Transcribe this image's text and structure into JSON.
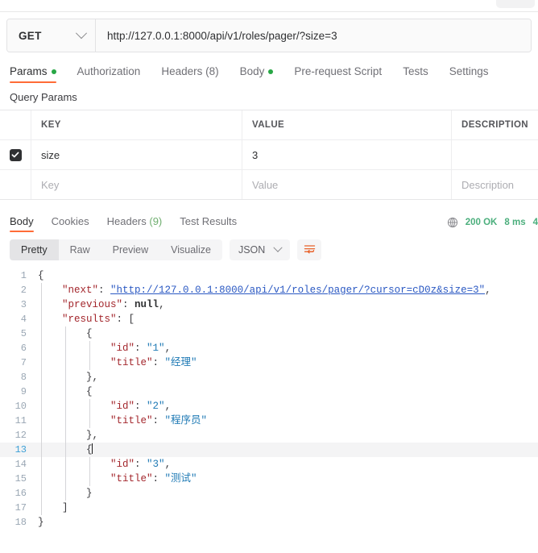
{
  "window": {
    "tab_chip": ""
  },
  "request": {
    "method": "GET",
    "url": "http://127.0.0.1:8000/api/v1/roles/pager/?size=3",
    "tabs": [
      {
        "label": "Params",
        "dot": true,
        "active": true
      },
      {
        "label": "Authorization",
        "dot": false,
        "active": false
      },
      {
        "label": "Headers (8)",
        "dot": false,
        "active": false
      },
      {
        "label": "Body",
        "dot": true,
        "active": false
      },
      {
        "label": "Pre-request Script",
        "dot": false,
        "active": false
      },
      {
        "label": "Tests",
        "dot": false,
        "active": false
      },
      {
        "label": "Settings",
        "dot": false,
        "active": false
      }
    ],
    "tab_labels": {
      "params": "Params",
      "authorization": "Authorization",
      "headers": "Headers (8)",
      "body": "Body",
      "prerequest": "Pre-request Script",
      "tests": "Tests",
      "settings": "Settings"
    }
  },
  "query_params": {
    "section_title": "Query Params",
    "columns": {
      "key": "KEY",
      "value": "VALUE",
      "description": "DESCRIPTION"
    },
    "rows": [
      {
        "checked": true,
        "key": "size",
        "value": "3",
        "description": ""
      }
    ],
    "placeholder_row": {
      "key": "Key",
      "value": "Value",
      "description": "Description"
    }
  },
  "response": {
    "tabs": {
      "body": "Body",
      "cookies": "Cookies",
      "headers_label": "Headers",
      "headers_count": "(9)",
      "test_results": "Test Results"
    },
    "status": "200 OK",
    "time": "8 ms",
    "size": "4",
    "format_tabs": {
      "pretty": "Pretty",
      "raw": "Raw",
      "preview": "Preview",
      "visualize": "Visualize"
    },
    "language": "JSON"
  },
  "code": {
    "lines": [
      {
        "num": "1",
        "active": false
      },
      {
        "num": "2",
        "active": false
      },
      {
        "num": "3",
        "active": false
      },
      {
        "num": "4",
        "active": false
      },
      {
        "num": "5",
        "active": false
      },
      {
        "num": "6",
        "active": false
      },
      {
        "num": "7",
        "active": false
      },
      {
        "num": "8",
        "active": false
      },
      {
        "num": "9",
        "active": false
      },
      {
        "num": "10",
        "active": false
      },
      {
        "num": "11",
        "active": false
      },
      {
        "num": "12",
        "active": false
      },
      {
        "num": "13",
        "active": true
      },
      {
        "num": "14",
        "active": false
      },
      {
        "num": "15",
        "active": false
      },
      {
        "num": "16",
        "active": false
      },
      {
        "num": "17",
        "active": false
      },
      {
        "num": "18",
        "active": false
      }
    ],
    "tokens": {
      "brace_open": "{",
      "brace_close": "}",
      "brace_close_comma": "},",
      "bracket_open": "[",
      "bracket_close": "]",
      "key_next": "\"next\"",
      "key_previous": "\"previous\"",
      "key_results": "\"results\"",
      "key_id": "\"id\"",
      "key_title": "\"title\"",
      "colon": ": ",
      "comma": ",",
      "val_next_url": "\"http://127.0.0.1:8000/api/v1/roles/pager/?cursor=cD0z&size=3\"",
      "val_null": "null",
      "val_id_1": "\"1\"",
      "val_id_2": "\"2\"",
      "val_id_3": "\"3\"",
      "val_title_1": "\"经理\"",
      "val_title_2": "\"程序员\"",
      "val_title_3": "\"测试\""
    },
    "response_json": {
      "next": "http://127.0.0.1:8000/api/v1/roles/pager/?cursor=cD0z&size=3",
      "previous": null,
      "results": [
        {
          "id": "1",
          "title": "经理"
        },
        {
          "id": "2",
          "title": "程序员"
        },
        {
          "id": "3",
          "title": "测试"
        }
      ]
    }
  },
  "colors": {
    "accent": "#ff6c37",
    "success": "#28a745",
    "status_green": "#4caf7d",
    "key_red": "#a3262c",
    "string_blue": "#1f7ab5",
    "url_blue": "#2b59c3",
    "gutter": "#9aa7b4",
    "active_gutter": "#3c9fd6"
  }
}
